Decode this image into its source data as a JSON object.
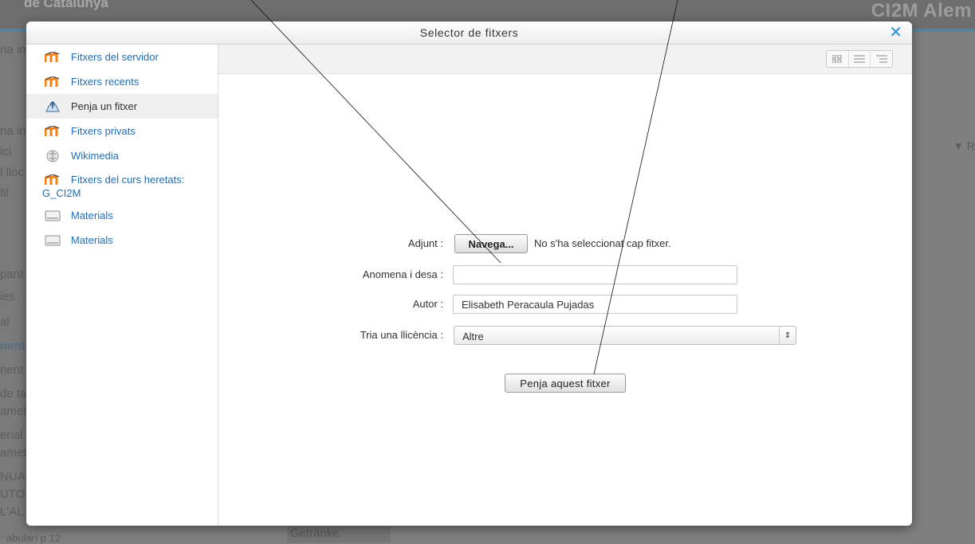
{
  "background": {
    "site_name": "de Catalunya",
    "course_name": "CI2M Alem",
    "left_items": [
      "na in",
      "na in",
      "ici",
      "l lloc",
      "fil",
      "pant",
      "ies",
      "al",
      "nent",
      "nent",
      "de ta",
      "amet",
      "erial",
      "amet",
      "NUA",
      "UTO",
      "L'AL"
    ],
    "right_item": "▼ R",
    "bottom_field": "Getränke",
    "bottom_text": "abulari p 12"
  },
  "dialog": {
    "title": "Selector de fitxers",
    "close": "✕"
  },
  "repositories": [
    {
      "label": "Fitxers del servidor",
      "icon": "moodle-icon"
    },
    {
      "label": "Fitxers recents",
      "icon": "moodle-icon"
    },
    {
      "label": "Penja un fitxer",
      "icon": "upload-icon",
      "active": true
    },
    {
      "label": "Fitxers privats",
      "icon": "moodle-icon"
    },
    {
      "label": "Wikimedia",
      "icon": "wikimedia-icon"
    },
    {
      "label": "Fitxers del curs heretats:",
      "label2": "G_CI2M",
      "icon": "moodle-icon"
    },
    {
      "label": "Materials",
      "icon": "folder-icon"
    },
    {
      "label": "Materials",
      "icon": "folder-icon"
    }
  ],
  "form": {
    "attachment_label": "Adjunt :",
    "browse_label": "Navega...",
    "no_file_text": "No s'ha seleccionat cap fitxer.",
    "save_as_label": "Anomena i desa :",
    "save_as_value": "",
    "author_label": "Autor :",
    "author_value": "Elisabeth Peracaula Pujadas",
    "license_label": "Tria una llicència :",
    "license_value": "Altre",
    "upload_button": "Penja aquest fitxer"
  },
  "colors": {
    "link": "#1f6db5",
    "accent": "#2e91d3",
    "moodle_orange": "#f98012"
  }
}
